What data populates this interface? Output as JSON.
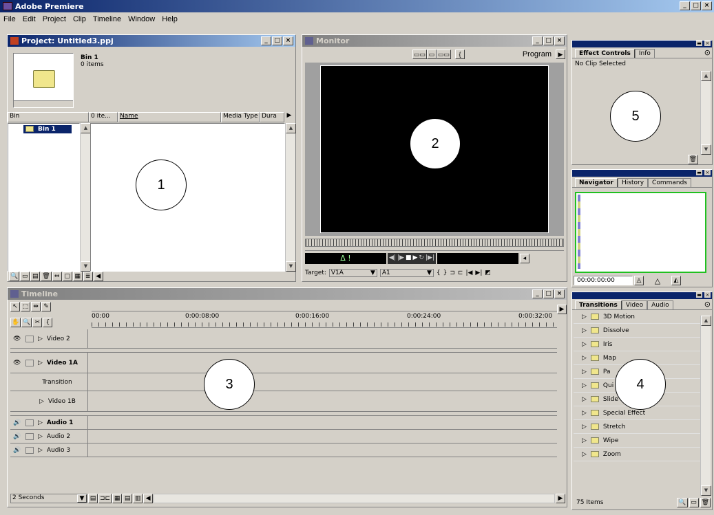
{
  "app": {
    "title": "Adobe Premiere",
    "controls": [
      "_",
      "□",
      "×"
    ]
  },
  "menu": [
    "File",
    "Edit",
    "Project",
    "Clip",
    "Timeline",
    "Window",
    "Help"
  ],
  "project": {
    "title": "Project: Untitled3.ppj",
    "bin_name": "Bin 1",
    "bin_count": "0 items",
    "col_bin": "Bin",
    "col_items": "0 ite...",
    "col_name": "Name",
    "col_media": "Media Type",
    "col_dura": "Dura",
    "tree_item": "Bin 1"
  },
  "monitor": {
    "title": "Monitor",
    "mode": "Program",
    "target_label": "Target:",
    "target_video": "V1A",
    "target_audio": "A1",
    "delta": "Δ !"
  },
  "timeline": {
    "title": "Timeline",
    "ruler": [
      "00:00",
      "0:00:08:00",
      "0:00:16:00",
      "0:00:24:00",
      "0:00:32:00"
    ],
    "tracks": [
      "Video 2",
      "Video 1A",
      "Transition",
      "Video 1B",
      "Audio 1",
      "Audio 2",
      "Audio 3"
    ],
    "zoom": "2 Seconds"
  },
  "effect_controls": {
    "tabs": [
      "Effect Controls",
      "Info"
    ],
    "status": "No Clip Selected"
  },
  "navigator": {
    "tabs": [
      "Navigator",
      "History",
      "Commands"
    ],
    "timecode": "00:00:00:00"
  },
  "transitions": {
    "tabs": [
      "Transitions",
      "Video",
      "Audio"
    ],
    "items": [
      "3D Motion",
      "Dissolve",
      "Iris",
      "Map",
      "Page Peel",
      "QuickTime",
      "Slide",
      "Special Effect",
      "Stretch",
      "Wipe",
      "Zoom"
    ],
    "visible_labels": [
      "3D Motion",
      "Dissolve",
      "Iris",
      "Map",
      "Pa",
      "Qui",
      "Slide",
      "Special Effect",
      "Stretch",
      "Wipe",
      "Zoom"
    ],
    "count": "75 Items"
  },
  "callouts": [
    "1",
    "2",
    "3",
    "4",
    "5"
  ]
}
